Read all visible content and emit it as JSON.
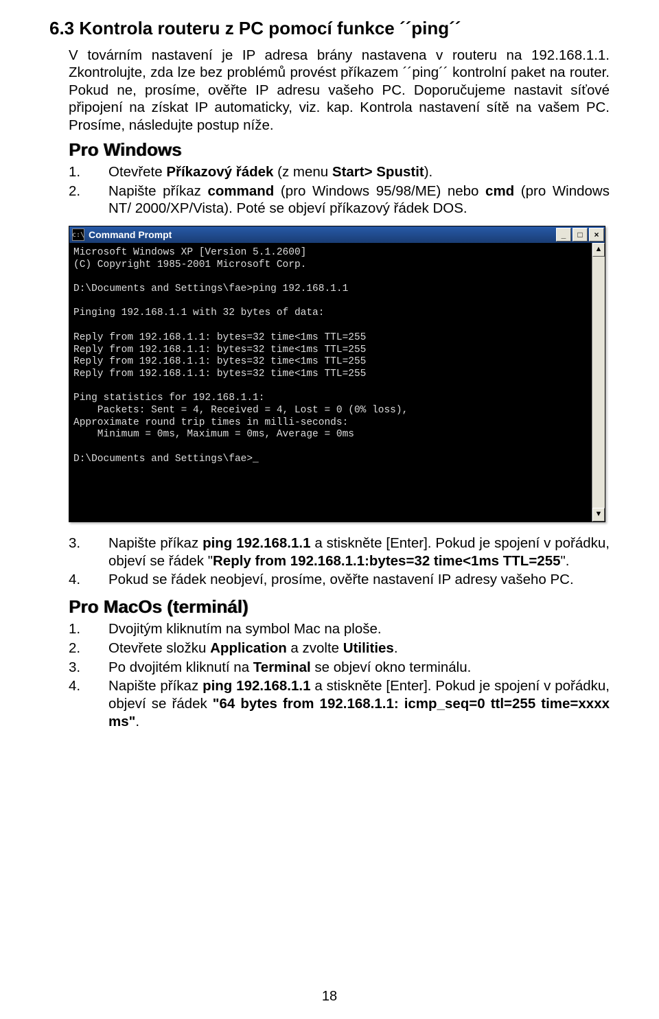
{
  "section": {
    "title": "6.3 Kontrola routeru z PC pomocí funkce ´´ping´´",
    "para": "V továrním nastavení je IP adresa brány nastavena v routeru na 192.168.1.1. Zkontrolujte, zda lze bez problémů provést příkazem ´´ping´´ kontrolní paket na router. Pokud ne, prosíme, ověřte IP adresu vašeho PC. Doporučujeme nastavit síťové připojení na získat IP automaticky, viz. kap. Kontrola nastavení sítě na vašem PC. Prosíme, následujte postup níže."
  },
  "windows": {
    "heading": "Pro Windows",
    "steps_a": [
      {
        "n": "1.",
        "pre": "Otevřete ",
        "b1": "Příkazový řádek",
        "mid": " (z menu ",
        "b2": "Start> Spustit",
        "post": ")."
      },
      {
        "n": "2.",
        "pre": "Napište příkaz ",
        "b1": "command",
        "mid": " (pro Windows 95/98/ME) nebo ",
        "b2": "cmd",
        "post": " (pro Windows NT/ 2000/XP/Vista). Poté se objeví příkazový řádek DOS."
      }
    ],
    "steps_b": [
      {
        "n": "3.",
        "pre": "Napište příkaz ",
        "b1": "ping 192.168.1.1",
        "mid": " a stiskněte [Enter]. Pokud je spojení v pořádku, objeví se řádek \"",
        "b2": "Reply from 192.168.1.1:bytes=32 time<1ms TTL=255",
        "post": "\"."
      },
      {
        "n": "4.",
        "pre": "Pokud se řádek neobjeví, prosíme, ověřte nastavení IP adresy vašeho PC.",
        "b1": "",
        "mid": "",
        "b2": "",
        "post": ""
      }
    ]
  },
  "macos": {
    "heading": "Pro MacOs (terminál)",
    "steps": [
      {
        "n": "1.",
        "txt": "Dvojitým kliknutím na symbol Mac na ploše."
      },
      {
        "n": "2.",
        "pre": "Otevřete složku ",
        "b1": "Application",
        "mid": " a zvolte ",
        "b2": "Utilities",
        "post": "."
      },
      {
        "n": "3.",
        "pre": "Po dvojitém kliknutí na ",
        "b1": "Terminal",
        "mid": " se objeví okno terminálu.",
        "b2": "",
        "post": ""
      },
      {
        "n": "4.",
        "pre": "Napište příkaz ",
        "b1": "ping 192.168.1.1",
        "mid": " a stiskněte [Enter]. Pokud je spojení v pořádku, objeví se řádek ",
        "b2": "\"64 bytes from 192.168.1.1: icmp_seq=0 ttl=255 time=xxxx ms\"",
        "post": "."
      }
    ]
  },
  "cmd": {
    "title": "Command Prompt",
    "icon_glyph": "c:\\",
    "min": "_",
    "max": "□",
    "close": "×",
    "scroll_up": "▲",
    "scroll_down": "▼",
    "output": "Microsoft Windows XP [Version 5.1.2600]\n(C) Copyright 1985-2001 Microsoft Corp.\n\nD:\\Documents and Settings\\fae>ping 192.168.1.1\n\nPinging 192.168.1.1 with 32 bytes of data:\n\nReply from 192.168.1.1: bytes=32 time<1ms TTL=255\nReply from 192.168.1.1: bytes=32 time<1ms TTL=255\nReply from 192.168.1.1: bytes=32 time<1ms TTL=255\nReply from 192.168.1.1: bytes=32 time<1ms TTL=255\n\nPing statistics for 192.168.1.1:\n    Packets: Sent = 4, Received = 4, Lost = 0 (0% loss),\nApproximate round trip times in milli-seconds:\n    Minimum = 0ms, Maximum = 0ms, Average = 0ms\n\nD:\\Documents and Settings\\fae>_"
  },
  "page_number": "18"
}
